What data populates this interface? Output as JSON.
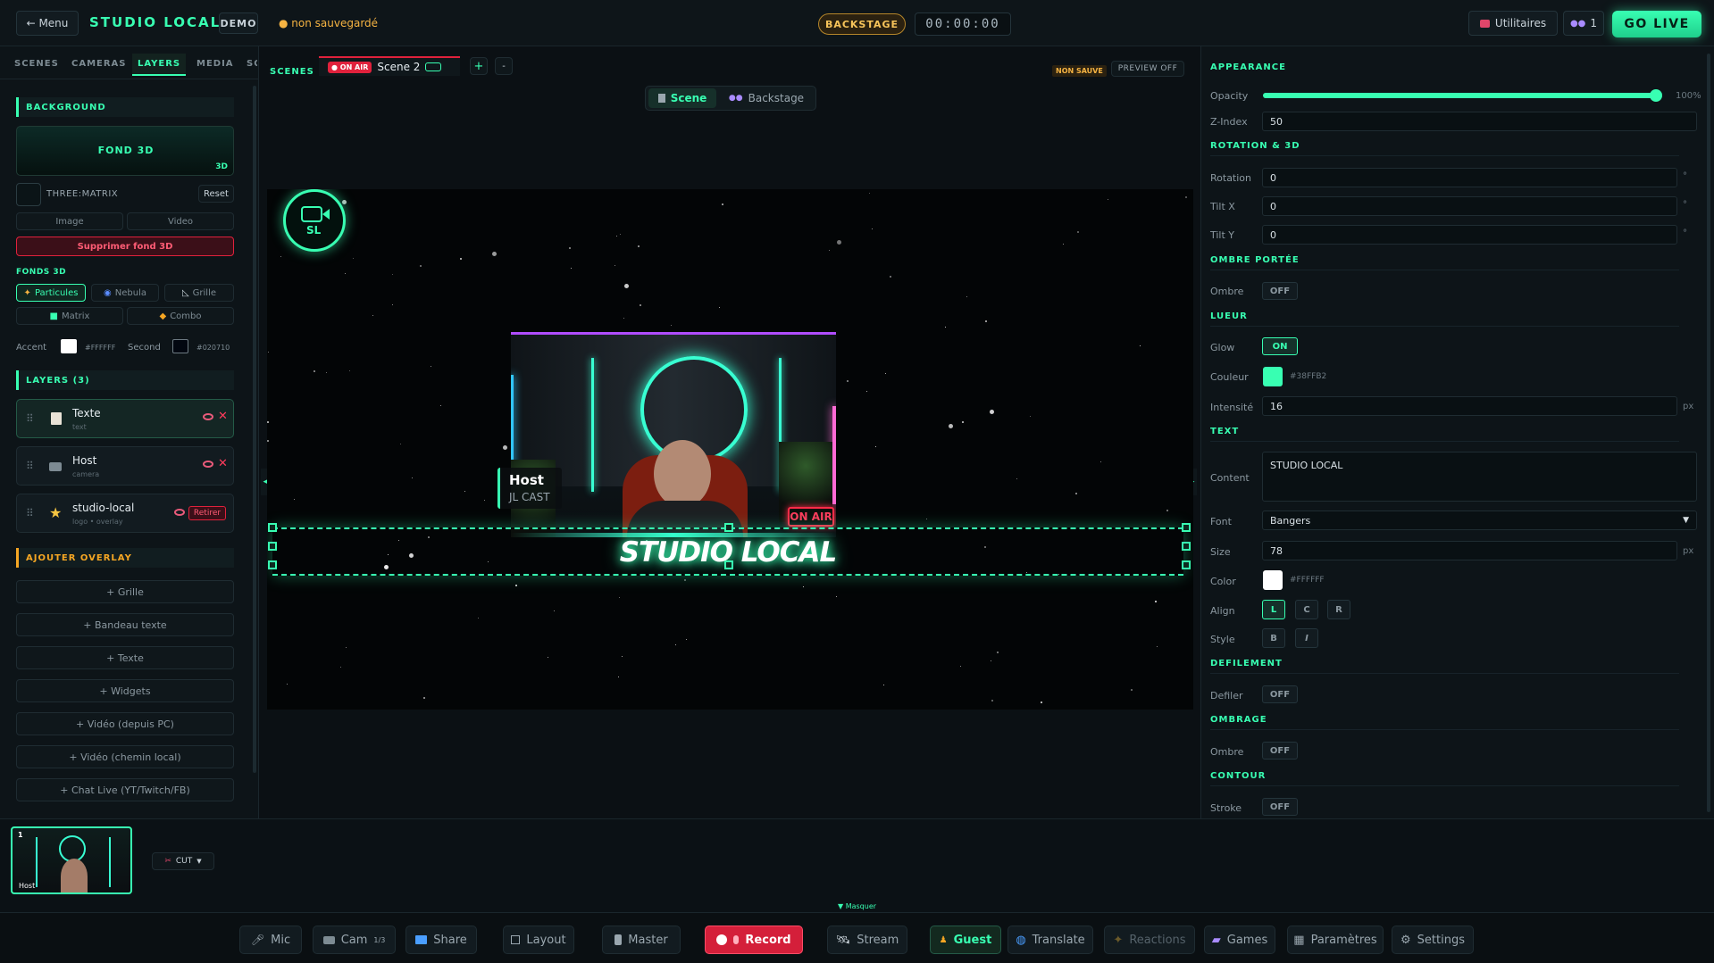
{
  "topbar": {
    "menu_label": "← Menu",
    "brand": "STUDIO LOCAL",
    "mode_badge": "DEMO",
    "unsaved_status": "● non sauvegardé",
    "backstage_badge": "BACKSTAGE",
    "timer": "00:00:00",
    "utilities_label": "Utilitaires",
    "guests_count": "1",
    "golive_label": "GO LIVE"
  },
  "left": {
    "tabs": [
      "SCENES",
      "CAMERAS",
      "LAYERS",
      "MEDIA",
      "SO"
    ],
    "background": {
      "title": "BACKGROUND",
      "preview_label": "FOND 3D",
      "preview_badge": "3D",
      "matrix_label": "THREE:MATRIX",
      "reset_label": "Reset",
      "image_label": "Image",
      "video_label": "Video",
      "delete_label": "Supprimer fond 3D"
    },
    "fonds3d": {
      "title": "FONDS 3D",
      "options": [
        "Particules",
        "Nebula",
        "Grille",
        "Matrix",
        "Combo"
      ],
      "accent_label": "Accent",
      "accent_hex": "#FFFFFF",
      "second_label": "Second",
      "second_hex": "#020710"
    },
    "layers": {
      "title": "LAYERS (3)",
      "items": [
        {
          "name": "Texte",
          "type": "text"
        },
        {
          "name": "Host",
          "type": "camera"
        },
        {
          "name": "studio-local",
          "type": "logo • overlay",
          "action": "Retirer"
        }
      ]
    },
    "add_overlay": {
      "title": "AJOUTER OVERLAY",
      "buttons": [
        "+ Grille",
        "+ Bandeau texte",
        "+ Texte",
        "+ Widgets",
        "+ Vidéo (depuis PC)",
        "+ Vidéo (chemin local)",
        "+ Chat Live (YT/Twitch/FB)"
      ]
    }
  },
  "center": {
    "scenes_label": "SCENES",
    "on_air_badge": "● ON AIR",
    "scene_name": "Scene 2",
    "non_sauve": "NON SAUVE",
    "preview_off": "PREVIEW OFF",
    "view_scene": "Scene",
    "view_backstage": "Backstage",
    "logo_text": "SL",
    "host_name": "Host",
    "host_subtitle": "JL CAST",
    "on_air_sign": "ON AIR",
    "overlay_text": "STUDIO LOCAL"
  },
  "right": {
    "appearance": {
      "title": "APPEARANCE",
      "opacity_label": "Opacity",
      "opacity_value": "100%",
      "opacity_fraction": 1.0,
      "zindex_label": "Z-Index",
      "zindex_value": "50"
    },
    "rotation": {
      "title": "ROTATION & 3D",
      "rotation_label": "Rotation",
      "rotation_value": "0",
      "tiltx_label": "Tilt X",
      "tiltx_value": "0",
      "tilty_label": "Tilt Y",
      "tilty_value": "0",
      "unit": "°"
    },
    "shadow": {
      "title": "OMBRE PORTÉE",
      "label": "Ombre",
      "state": "OFF"
    },
    "glow": {
      "title": "LUEUR",
      "glow_label": "Glow",
      "glow_state": "ON",
      "color_label": "Couleur",
      "color_hex": "#38FFB2",
      "intensity_label": "Intensité",
      "intensity_value": "16",
      "unit": "px"
    },
    "text": {
      "title": "TEXT",
      "content_label": "Content",
      "content_value": "STUDIO LOCAL",
      "font_label": "Font",
      "font_value": "Bangers",
      "size_label": "Size",
      "size_value": "78",
      "size_unit": "px",
      "color_label": "Color",
      "color_hex": "#FFFFFF",
      "align_label": "Align",
      "align_options": [
        "L",
        "C",
        "R"
      ],
      "style_label": "Style",
      "style_options": [
        "B",
        "I"
      ]
    },
    "scroll": {
      "title": "DEFILEMENT",
      "label": "Defiler",
      "state": "OFF"
    },
    "ombrage": {
      "title": "OMBRAGE",
      "label": "Ombre",
      "state": "OFF"
    },
    "contour": {
      "title": "CONTOUR",
      "label": "Stroke",
      "state": "OFF"
    }
  },
  "bottom": {
    "thumb_index": "1",
    "thumb_label": "Host",
    "transition_label": "CUT",
    "hide_label": "▼ Masquer",
    "dock": [
      {
        "label": "Mic",
        "icon": "mic-icon"
      },
      {
        "label": "Cam",
        "badge": "1/3",
        "icon": "camera-icon"
      },
      {
        "label": "Share",
        "icon": "monitor-icon"
      },
      {
        "label": "Layout",
        "icon": "layout-icon"
      },
      {
        "label": "Master",
        "icon": "master-icon"
      },
      {
        "label": "Record",
        "icon": "record-icon"
      },
      {
        "label": "Stream",
        "icon": "satellite-icon"
      },
      {
        "label": "Guest",
        "icon": "guest-icon"
      },
      {
        "label": "Translate",
        "icon": "globe-icon"
      },
      {
        "label": "Reactions",
        "icon": "sparkle-icon"
      },
      {
        "label": "Games",
        "icon": "gamepad-icon"
      },
      {
        "label": "Paramètres",
        "icon": "grid-icon"
      },
      {
        "label": "Settings",
        "icon": "gear-icon"
      }
    ]
  },
  "colors": {
    "accent": "#38ffb2",
    "record": "#e0213c",
    "warning": "#f5b342"
  }
}
